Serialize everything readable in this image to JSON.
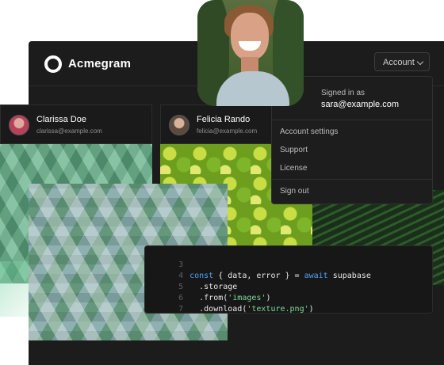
{
  "app": {
    "title": "Acmegram",
    "account_label": "Account"
  },
  "menu": {
    "signed_in_label": "Signed in as",
    "email": "sara@example.com",
    "items": [
      "Account settings",
      "Support",
      "License"
    ],
    "signout": "Sign out"
  },
  "users": [
    {
      "name": "Clarissa Doe",
      "email": "clarissa@example.com"
    },
    {
      "name": "Felicia Rando",
      "email": "felicia@example.com"
    }
  ],
  "code": {
    "line_numbers": [
      "3",
      "4",
      "5",
      "6",
      "7"
    ],
    "l4": {
      "kw1": "const",
      "mid": " { data, error } = ",
      "kw2": "await",
      "end": " supabase"
    },
    "l5": "  .storage",
    "l6": {
      "pre": "  .from(",
      "str": "'images'",
      "post": ")"
    },
    "l7": {
      "pre": "  .download(",
      "str": "'texture.png'",
      "post": ")"
    }
  },
  "colors": {
    "background": "#1c1c1c",
    "keyword": "#4fa3f7",
    "string": "#7fd99a"
  }
}
